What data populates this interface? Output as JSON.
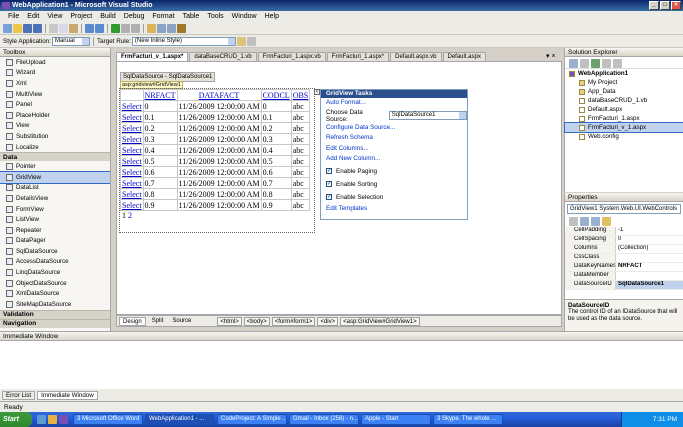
{
  "window": {
    "title": "WebApplication1 - Microsoft Visual Studio"
  },
  "menu": [
    "File",
    "Edit",
    "View",
    "Project",
    "Build",
    "Debug",
    "Format",
    "Table",
    "Tools",
    "Window",
    "Help"
  ],
  "style_toolbar": {
    "style_app_label": "Style Application:",
    "style_app_value": "Manual",
    "target_rule_label": "Target Rule:",
    "target_rule_value": "(New Inline Style)"
  },
  "toolbox": {
    "title": "Toolbox",
    "items_top": [
      "FileUpload",
      "Wizard",
      "Xml",
      "MultiView",
      "Panel",
      "PlaceHolder",
      "View",
      "Substitution",
      "Localize"
    ],
    "data_section": "Data",
    "data_items": [
      "Pointer",
      "GridView",
      "DataList",
      "DetailsView",
      "FormView",
      "ListView",
      "Repeater",
      "DataPager",
      "SqlDataSource",
      "AccessDataSource",
      "LinqDataSource",
      "ObjectDataSource",
      "XmlDataSource",
      "SiteMapDataSource"
    ],
    "sections_bottom": [
      "Validation",
      "Navigation"
    ]
  },
  "doc_tabs": [
    "FrmFacturi_v_1.aspx*",
    "dataBaseCRUD_1.vb",
    "FrmFacturi_1.aspx.vb",
    "FrmFacturi_1.aspx*",
    "Default.aspx.vb",
    "Default.aspx"
  ],
  "designer": {
    "sqlds_label": "SqlDataSource - SqlDataSource1",
    "gridview_tag": "asp:gridview#GridView1",
    "columns": [
      "",
      "NRFACT",
      "DATAFACT",
      "CODCL",
      "OBS"
    ],
    "rows": [
      {
        "sel": "Select",
        "nr": "0",
        "date": "11/26/2009 12:00:00 AM",
        "cod": "0",
        "obs": "abc"
      },
      {
        "sel": "Select",
        "nr": "0.1",
        "date": "11/26/2009 12:00:00 AM",
        "cod": "0.1",
        "obs": "abc"
      },
      {
        "sel": "Select",
        "nr": "0.2",
        "date": "11/26/2009 12:00:00 AM",
        "cod": "0.2",
        "obs": "abc"
      },
      {
        "sel": "Select",
        "nr": "0.3",
        "date": "11/26/2009 12:00:00 AM",
        "cod": "0.3",
        "obs": "abc"
      },
      {
        "sel": "Select",
        "nr": "0.4",
        "date": "11/26/2009 12:00:00 AM",
        "cod": "0.4",
        "obs": "abc"
      },
      {
        "sel": "Select",
        "nr": "0.5",
        "date": "11/26/2009 12:00:00 AM",
        "cod": "0.5",
        "obs": "abc"
      },
      {
        "sel": "Select",
        "nr": "0.6",
        "date": "11/26/2009 12:00:00 AM",
        "cod": "0.6",
        "obs": "abc"
      },
      {
        "sel": "Select",
        "nr": "0.7",
        "date": "11/26/2009 12:00:00 AM",
        "cod": "0.7",
        "obs": "abc"
      },
      {
        "sel": "Select",
        "nr": "0.8",
        "date": "11/26/2009 12:00:00 AM",
        "cod": "0.8",
        "obs": "abc"
      },
      {
        "sel": "Select",
        "nr": "0.9",
        "date": "11/26/2009 12:00:00 AM",
        "cod": "0.9",
        "obs": "abc"
      }
    ],
    "pager": {
      "current": "1",
      "next": "2"
    }
  },
  "tasks": {
    "title": "GridView Tasks",
    "auto_format": "Auto Format...",
    "choose_ds_label": "Choose Data Source:",
    "choose_ds_value": "SqlDataSource1",
    "links": [
      "Configure Data Source...",
      "Refresh Schema",
      "Edit Columns...",
      "Add New Column..."
    ],
    "checks": [
      "Enable Paging",
      "Enable Sorting",
      "Enable Selection"
    ],
    "edit_templates": "Edit Templates"
  },
  "bottom_tabs": {
    "design": "Design",
    "split": "Split",
    "source": "Source",
    "crumbs": [
      "<html>",
      "<body>",
      "<form#form1>",
      "<div>",
      "<asp:GridView#GridView1>"
    ]
  },
  "solution": {
    "title": "Solution Explorer",
    "project": "WebApplication1",
    "items": [
      "My Project",
      "App_Data",
      "dataBaseCRUD_1.vb",
      "Default.aspx",
      "FrmFacturi_1.aspx",
      "FrmFacturi_v_1.aspx",
      "Web.config"
    ]
  },
  "properties": {
    "title": "Properties",
    "object": "GridView1 System.Web.UI.WebControls",
    "rows": [
      [
        "CellPadding",
        "-1"
      ],
      [
        "CellSpacing",
        "0"
      ],
      [
        "Columns",
        "(Collection)"
      ],
      [
        "CssClass",
        ""
      ],
      [
        "DataKeyNames",
        "NRFACT"
      ],
      [
        "DataMember",
        ""
      ],
      [
        "DataSourceID",
        "SqlDataSource1"
      ]
    ],
    "desc_title": "DataSourceID",
    "desc_text": "The control ID of an IDataSource that will be used as the data source."
  },
  "immediate": {
    "title": "Immediate Window",
    "tab_errors": "Error List",
    "tab_immediate": "Immediate Window"
  },
  "status": "Ready",
  "taskbar": {
    "start": "Start",
    "buttons": [
      "3 Microsoft Office Word",
      "WebApplication1 - ...",
      "CodeProject: A Simple ...",
      "Gmail - Inbox (258) - n...",
      "Apple - Start",
      "3 Skype. The whole ..."
    ],
    "clock": "7:31 PM"
  }
}
